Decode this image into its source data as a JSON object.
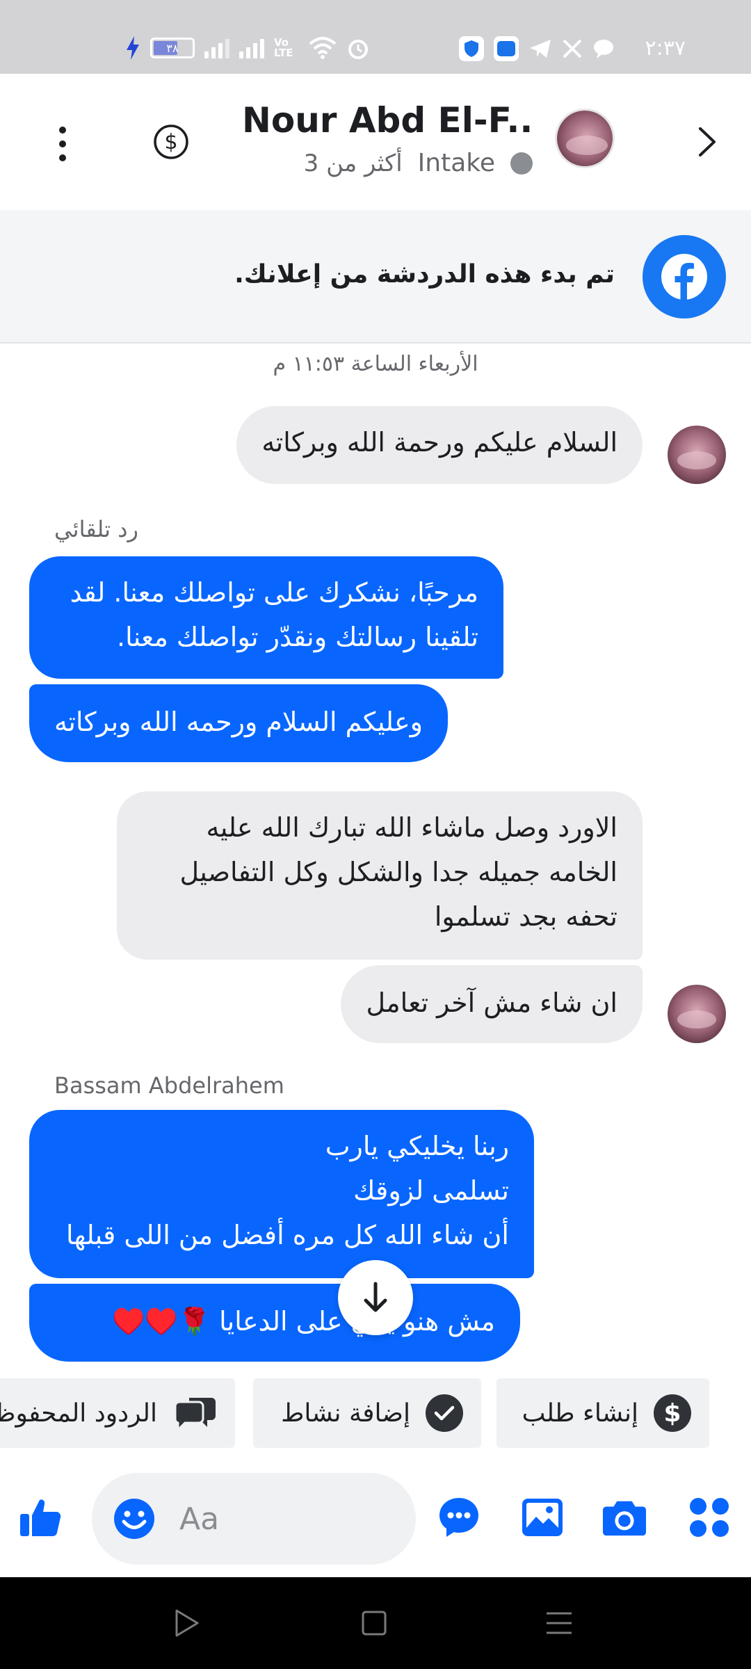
{
  "status_bar": {
    "time": "٢:٣٧",
    "battery": "٣٨",
    "volte_label": "Vo LTE"
  },
  "header": {
    "contact_name": "Nour Abd El-F...",
    "pipeline_stage": "Intake",
    "more_count": "أكثر من 3"
  },
  "ad_banner": {
    "text": "تم بدء هذه الدردشة من إعلانك."
  },
  "conversation": {
    "timestamp": "الأربعاء الساعة ١١:٥٣ م",
    "auto_reply_label": "رد تلقائي",
    "sender_name": "Bassam Abdelrahem",
    "messages": [
      {
        "direction": "incoming",
        "text": "السلام عليكم ورحمة الله وبركاته"
      },
      {
        "direction": "outgoing",
        "text": "مرحبًا، نشكرك على تواصلك معنا. لقد تلقينا رسالتك ونقدّر تواصلك معنا."
      },
      {
        "direction": "outgoing",
        "text": "وعليكم السلام ورحمه الله وبركاته"
      },
      {
        "direction": "incoming",
        "text": "الاورد وصل ماشاء الله تبارك الله عليه الخامه جميله جدا والشكل وكل التفاصيل تحفه بجد تسلموا"
      },
      {
        "direction": "incoming",
        "text": "ان شاء مش آخر تعامل"
      },
      {
        "direction": "outgoing",
        "text": "ربنا يخليكي يارب\nتسلمى لزوقك\nأن شاء الله كل مره أفضل من اللى قبلها"
      },
      {
        "direction": "outgoing",
        "text": "مش هنو يكي على الدعايا 🌹♥️♥️"
      }
    ]
  },
  "quick_actions": {
    "create_order": "إنشاء طلب",
    "add_activity": "إضافة نشاط",
    "saved_replies": "الردود المحفوظة"
  },
  "composer": {
    "placeholder": "Aa"
  },
  "colors": {
    "brand_blue": "#0866ff",
    "facebook_blue": "#1877f2",
    "incoming_bubble": "#ececef"
  },
  "icons": [
    "back-arrow-icon",
    "dollar-icon",
    "kebab-menu-icon",
    "facebook-icon",
    "arrow-down-icon",
    "check-icon",
    "chat-bubbles-icon",
    "like-icon",
    "emoji-icon",
    "chat-dots-icon",
    "image-icon",
    "camera-icon",
    "apps-grid-icon"
  ]
}
